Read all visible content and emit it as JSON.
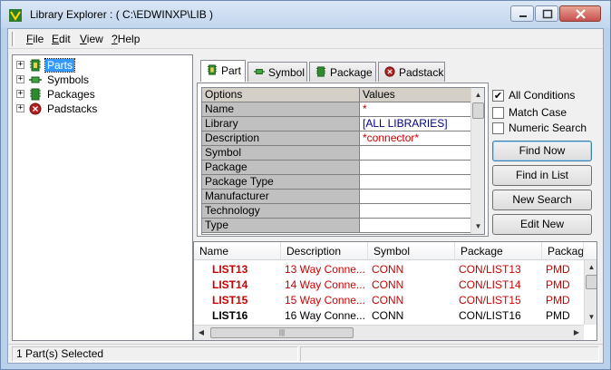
{
  "window": {
    "title": "Library Explorer : ( C:\\EDWINXP\\LIB )"
  },
  "menu": [
    {
      "key": "F",
      "rest": "ile"
    },
    {
      "key": "E",
      "rest": "dit"
    },
    {
      "key": "V",
      "rest": "iew"
    },
    {
      "key": "?",
      "rest": "Help"
    }
  ],
  "tree": [
    {
      "label": "Parts",
      "icon": "part-icon",
      "selected": true
    },
    {
      "label": "Symbols",
      "icon": "symbol-icon",
      "selected": false
    },
    {
      "label": "Packages",
      "icon": "package-icon",
      "selected": false
    },
    {
      "label": "Padstacks",
      "icon": "padstack-icon",
      "selected": false
    }
  ],
  "tabs": [
    {
      "label": "Part",
      "icon": "part-icon",
      "active": true
    },
    {
      "label": "Symbol",
      "icon": "symbol-icon",
      "active": false
    },
    {
      "label": "Package",
      "icon": "package-icon",
      "active": false
    },
    {
      "label": "Padstack",
      "icon": "padstack-icon",
      "active": false
    }
  ],
  "grid": {
    "headers": {
      "options": "Options",
      "values": "Values"
    },
    "rows": [
      {
        "option": "Name",
        "value": "*",
        "value_color": "#cc0000"
      },
      {
        "option": "Library",
        "value": "[ALL LIBRARIES]",
        "value_color": "#00008b"
      },
      {
        "option": "Description",
        "value": "*connector*",
        "value_color": "#cc0000"
      },
      {
        "option": "Symbol",
        "value": "",
        "value_color": "#000000"
      },
      {
        "option": "Package",
        "value": "",
        "value_color": "#000000"
      },
      {
        "option": "Package Type",
        "value": "",
        "value_color": "#000000"
      },
      {
        "option": "Manufacturer",
        "value": "",
        "value_color": "#000000"
      },
      {
        "option": "Technology",
        "value": "",
        "value_color": "#000000"
      },
      {
        "option": "Type",
        "value": "",
        "value_color": "#000000"
      }
    ]
  },
  "checkboxes": [
    {
      "label": "All Conditions",
      "checked": true,
      "mark": "✔"
    },
    {
      "label": "Match Case",
      "checked": false,
      "mark": ""
    },
    {
      "label": "Numeric Search",
      "checked": false,
      "mark": ""
    }
  ],
  "buttons": [
    {
      "label": "Find Now"
    },
    {
      "label": "Find in List"
    },
    {
      "label": "New Search"
    },
    {
      "label": "Edit New"
    }
  ],
  "results": {
    "columns": [
      "Name",
      "Description",
      "Symbol",
      "Package",
      "Package"
    ],
    "rows": [
      {
        "name": "LIST13",
        "description": "13 Way Conne...",
        "symbol": "CONN",
        "package": "CON/LIST13",
        "extra": "PMD",
        "color": "#cc0000"
      },
      {
        "name": "LIST14",
        "description": "14 Way Conne...",
        "symbol": "CONN",
        "package": "CON/LIST14",
        "extra": "PMD",
        "color": "#cc0000"
      },
      {
        "name": "LIST15",
        "description": "15 Way Conne...",
        "symbol": "CONN",
        "package": "CON/LIST15",
        "extra": "PMD",
        "color": "#cc0000"
      },
      {
        "name": "LIST16",
        "description": "16 Way Conne...",
        "symbol": "CONN",
        "package": "CON/LIST16",
        "extra": "PMD",
        "color": "#000000"
      }
    ]
  },
  "status": {
    "selection": "1 Part(s) Selected"
  }
}
